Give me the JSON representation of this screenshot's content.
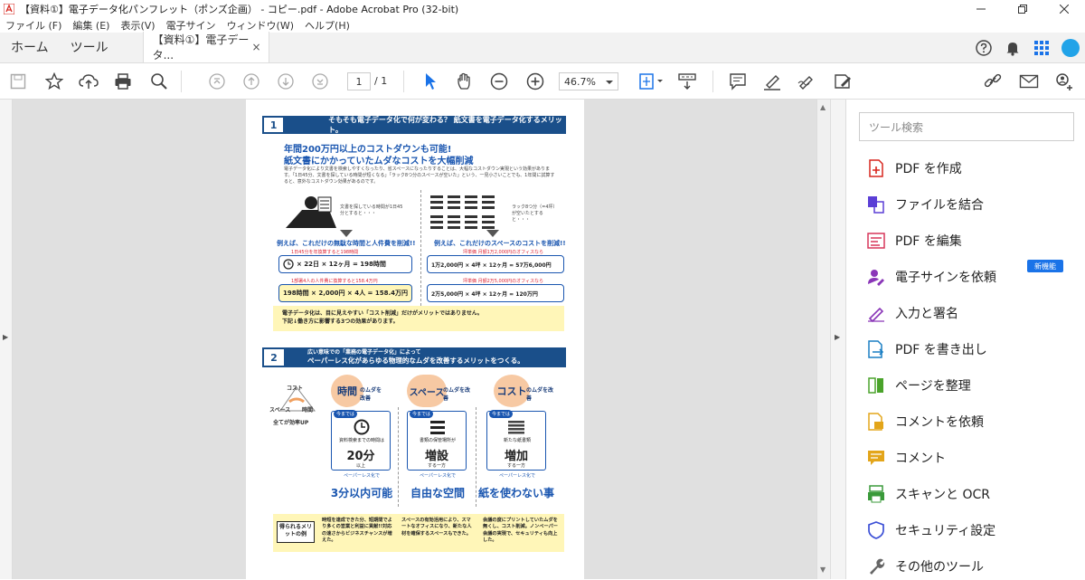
{
  "window": {
    "title": "【資料①】電子データ化パンフレット（ポンズ企画） - コピー.pdf - Adobe Acrobat Pro (32-bit)"
  },
  "menu": [
    "ファイル (F)",
    "編集 (E)",
    "表示(V)",
    "電子サイン",
    "ウィンドウ(W)",
    "ヘルプ(H)"
  ],
  "tabs": {
    "home": "ホーム",
    "tools": "ツール",
    "doc": "【資料①】電子データ...",
    "close": "×"
  },
  "toolbar": {
    "page_current": "1",
    "page_total": "/ 1",
    "zoom": "46.7%"
  },
  "document": {
    "s1_num": "1",
    "s1_header": "そもそも電子データ化で何が変わる？ 紙文書を電子データ化するメリット。",
    "s1_title1": "年間200万円以上のコストダウンも可能!",
    "s1_title2": "紙文書にかかっていたムダなコストを大幅削減",
    "s1_body": "電子データ化により文書を検索しやすくなったり、省スペースになったりすることは、大幅なコストダウン実現という効果があります。「1日45分、文書を探している時間が短くなる」「ラック8つ分のスペースが空いた」という、一見小さいことでも、1年間に試算すると、意外なコストダウン効果があるのです。",
    "left_note": "文書を探している時間が1日45分とすると・・・",
    "right_note": "ラック8つ分（=4坪）が空いたとすると・・・",
    "left_head": "例えば、これだけの無駄な時間と人件費を削減!!",
    "right_head": "例えば、これだけのスペースのコストを削減!!",
    "left_sub1": "1日45分を年換算すると198時間",
    "left_calc1": "× 22日 × 12ヶ月 = 198時間",
    "left_sub2": "1部署4人の人件費に換算すると158.4万円",
    "left_calc2": "198時間 × 2,000円 × 4人 = 158.4万円",
    "right_sub1": "坪単価 月額1万2,000円のオフィスなら",
    "right_calc1": "1万2,000円 × 4坪 × 12ヶ月 = 57万6,000円",
    "right_sub2": "坪単価 月額2万5,000円のオフィスなら",
    "right_calc2": "2万5,000円 × 4坪 × 12ヶ月 = 120万円",
    "yellow1_line1": "電子データ化は、目に見えやすい「コスト削減」だけがメリットではありません。",
    "yellow1_line2": "下記↓働き方に影響する3つの効果があります。",
    "s2_num": "2",
    "s2_header1": "広い意味での「業務の電子データ化」によって",
    "s2_header2": "ペーパーレス化があらゆる物理的なムダを改善するメリットをつくる。",
    "triangle": {
      "top": "コスト",
      "left": "スペース",
      "right": "時間",
      "bottom": "全てが効率UP"
    },
    "cols": [
      {
        "circle": "時間",
        "suffix": "のムダを改善",
        "now": "今までは",
        "desc": "資料検索までの時間は",
        "big": "20分",
        "unit": "以上",
        "arrow_label": "ペーパーレス化で",
        "result": "3分以内可能",
        "merit": "時短を達成できた分、短期間でより多くの営業と利益に貢献!!対応の速さからビジネスチャンスが増えた。"
      },
      {
        "circle": "スペース",
        "suffix": "のムダを改善",
        "now": "今までは",
        "desc": "書類の保管場所が",
        "big": "増設",
        "unit": "する一方",
        "arrow_label": "ペーパーレス化で",
        "result": "自由な空間",
        "merit": "スペースの有効活用により、スマートなオフィスになり、新たな人材を確保するスペースもできた。"
      },
      {
        "circle": "コスト",
        "suffix": "のムダを改善",
        "now": "今までは",
        "desc": "新たな紙書類",
        "big": "増加",
        "unit": "する一方",
        "arrow_label": "ペーパーレス化で",
        "result": "紙を使わない事",
        "merit": "会議の度にプリントしていたムダを無くし、コスト削減。ノンペーパー会議の実現で、セキュリティも向上した。"
      }
    ],
    "merit_label": "得られるメリットの例"
  },
  "rightpane": {
    "search_placeholder": "ツール検索",
    "new_badge": "新機能",
    "tools": [
      "PDF を作成",
      "ファイルを結合",
      "PDF を編集",
      "電子サインを依頼",
      "入力と署名",
      "PDF を書き出し",
      "ページを整理",
      "コメントを依頼",
      "コメント",
      "スキャンと OCR",
      "セキュリティ設定",
      "その他のツール"
    ]
  },
  "colors": {
    "acrobat_red": "#d7261e",
    "doc_blue": "#1a4f8a",
    "accent_blue": "#1a56b0",
    "yellow": "#fff6b8",
    "peach": "#f7c9a3"
  }
}
